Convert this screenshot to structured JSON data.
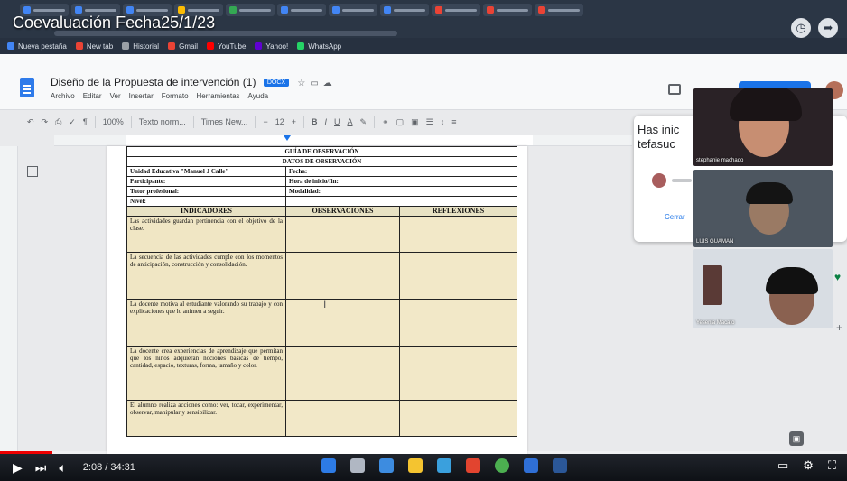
{
  "video": {
    "title": "Coevaluación Fecha25/1/23",
    "time": "2:08 / 34:31",
    "progress_fraction": 0.062
  },
  "docs": {
    "title": "Diseño de la Propuesta de intervención (1)",
    "badge": "DOCX",
    "menu": [
      "Archivo",
      "Editar",
      "Ver",
      "Insertar",
      "Formato",
      "Herramientas",
      "Ayuda"
    ],
    "toolbar": {
      "zoom": "100%",
      "style": "Texto norm...",
      "font": "Times New...",
      "size": "12"
    }
  },
  "bookmarks": [
    "Nueva pestaña",
    "New tab",
    "Historial",
    "Gmail",
    "YouTube",
    "Yahoo!",
    "WhatsApp"
  ],
  "table": {
    "title1": "GUÍA DE OBSERVACIÓN",
    "title2": "DATOS DE OBSERVACIÓN",
    "info": [
      [
        "Unidad Educativa \"Manuel J Calle\"",
        "Fecha:"
      ],
      [
        "Participante:",
        "Hora de inicio/fin:"
      ],
      [
        "Tutor profesional:",
        "Modalidad:"
      ],
      [
        "Nivel:",
        ""
      ]
    ],
    "headers": [
      "INDICADORES",
      "OBSERVACIONES",
      "REFLEXIONES"
    ],
    "indicators": [
      "Las actividades guardan pertinencia con el objetivo de la clase.",
      "La secuencia de las actividades cumple con los momentos de anticipación, construcción y consolidación.",
      "La docente motiva al estudiante valorando su trabajo y con explicaciones que lo animen a seguir.",
      "La docente crea experiencias de aprendizaje que permitan que los niños adquieran nociones básicas de tiempo, cantidad, espacio, texturas, forma, tamaño y color.",
      "El alumno realiza acciones como: ver, tocar, experimentar, observar, manipular y sensibilizar."
    ]
  },
  "side_panel": {
    "text": "Has inic tefasuc",
    "link": "Cerrar"
  },
  "participants": [
    {
      "name": "stephanie machado"
    },
    {
      "name": "LUIS GUAMAN"
    },
    {
      "name": "Yesenia Macato"
    }
  ]
}
